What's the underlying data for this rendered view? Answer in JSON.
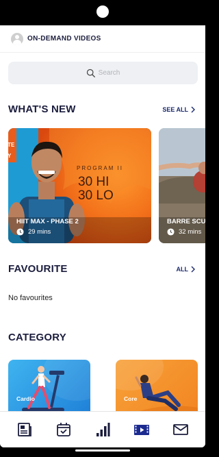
{
  "header": {
    "title": "ON-DEMAND VIDEOS"
  },
  "search": {
    "placeholder": "Search"
  },
  "whats_new": {
    "title": "WHAT'S NEW",
    "link_label": "SEE ALL",
    "cards": [
      {
        "name": "HIIT MAX - PHASE 2",
        "duration": "29 mins",
        "art_text_1": "PROGRAM II",
        "art_text_2": "30 HI",
        "art_text_3": "30 LO",
        "art_side_1": "TE",
        "art_side_2": "Y"
      },
      {
        "name": "BARRE SCULPT",
        "duration": "32 mins"
      }
    ]
  },
  "favourite": {
    "title": "FAVOURITE",
    "link_label": "ALL",
    "empty_text": "No favourites"
  },
  "category": {
    "title": "CATEGORY",
    "items": [
      {
        "label": "Cardio",
        "color": "#2a9be6"
      },
      {
        "label": "Core",
        "color": "#f59232"
      }
    ]
  },
  "bottom_nav": {
    "items": [
      {
        "icon": "news-icon",
        "active": false
      },
      {
        "icon": "calendar-check-icon",
        "active": false
      },
      {
        "icon": "bar-chart-icon",
        "active": false
      },
      {
        "icon": "video-icon",
        "active": true
      },
      {
        "icon": "mail-icon",
        "active": false
      }
    ]
  },
  "colors": {
    "navy": "#1b1d3d",
    "accent_blue": "#1b2a6b",
    "card_blue": "#1e9bd3",
    "card_orange": "#f07a1a"
  }
}
